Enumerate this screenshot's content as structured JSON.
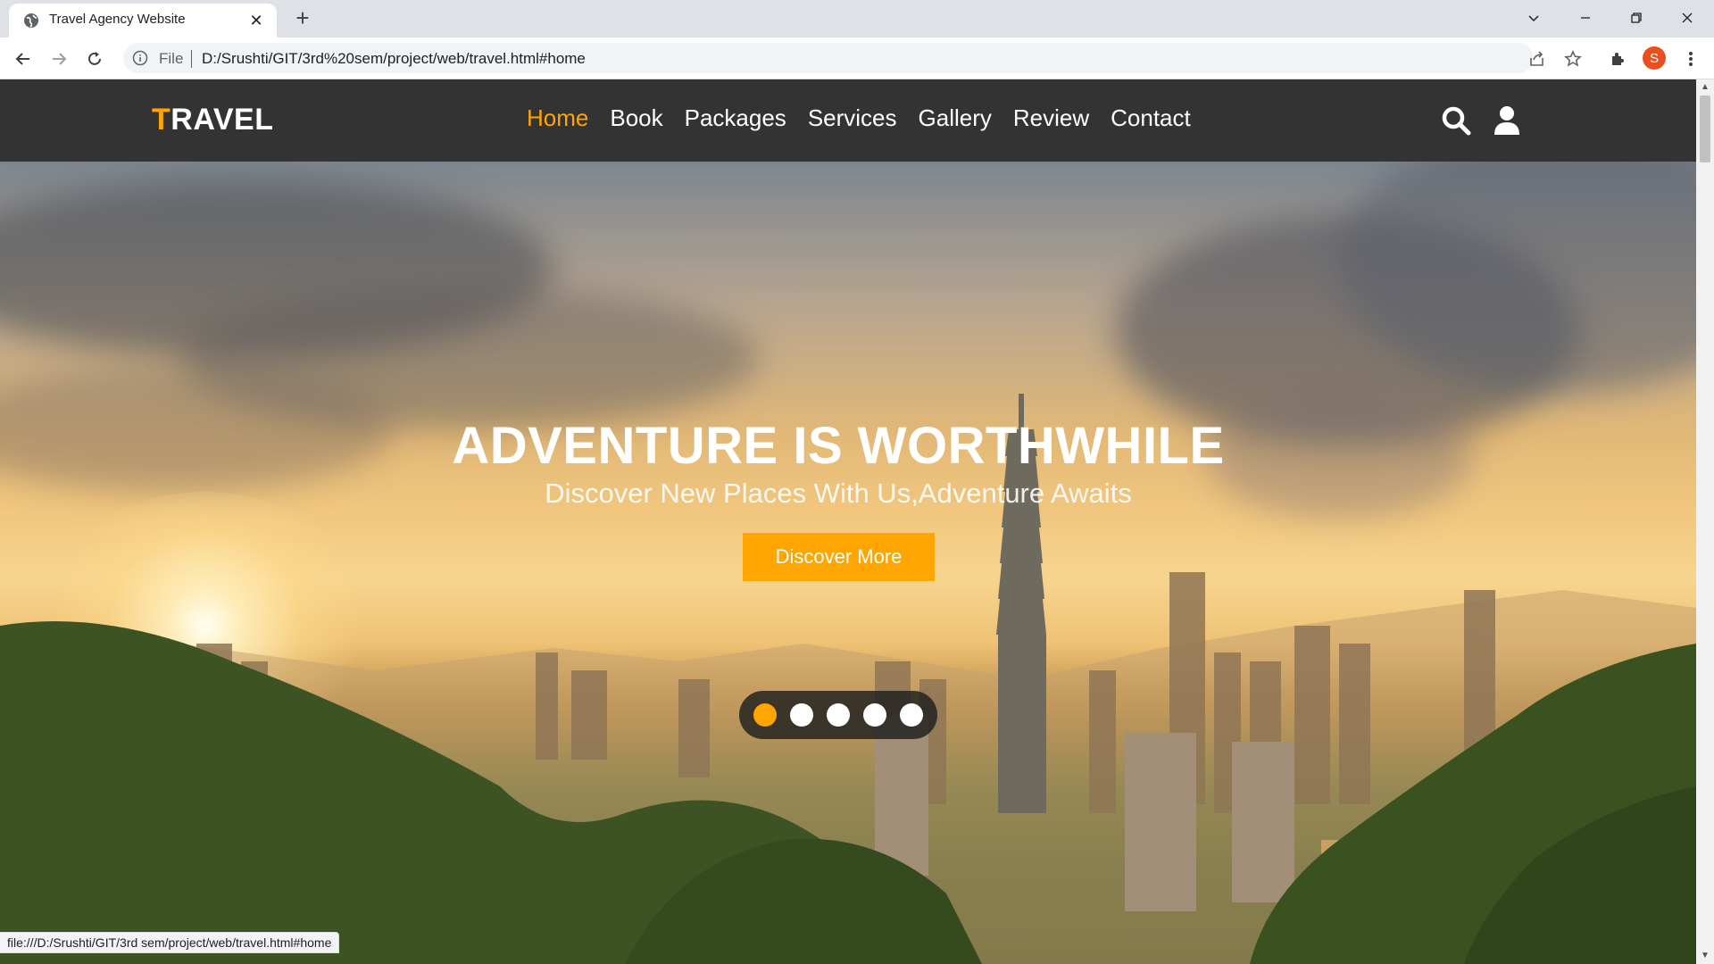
{
  "browser": {
    "tab_title": "Travel Agency Website",
    "tab_close": "✕",
    "new_tab": "+",
    "omnibox_scheme": "File",
    "url": "D:/Srushti/GIT/3rd%20sem/project/web/travel.html#home",
    "profile_initial": "S",
    "status_url": "file:///D:/Srushti/GIT/3rd sem/project/web/travel.html#home"
  },
  "site": {
    "logo_first": "T",
    "logo_rest": "RAVEL",
    "nav": [
      {
        "label": "Home",
        "active": true
      },
      {
        "label": "Book"
      },
      {
        "label": "Packages"
      },
      {
        "label": "Services"
      },
      {
        "label": "Gallery"
      },
      {
        "label": "Review"
      },
      {
        "label": "Contact"
      }
    ],
    "icons": [
      "search-icon",
      "user-icon"
    ]
  },
  "hero": {
    "title": "ADVENTURE IS WORTHWHILE",
    "subtitle": "Discover New Places With Us,Adventure Awaits",
    "button": "Discover More",
    "slides": 5,
    "active_slide": 1
  },
  "colors": {
    "accent": "#ffa500",
    "header_bg": "#333333",
    "profile": "#e8501f"
  }
}
